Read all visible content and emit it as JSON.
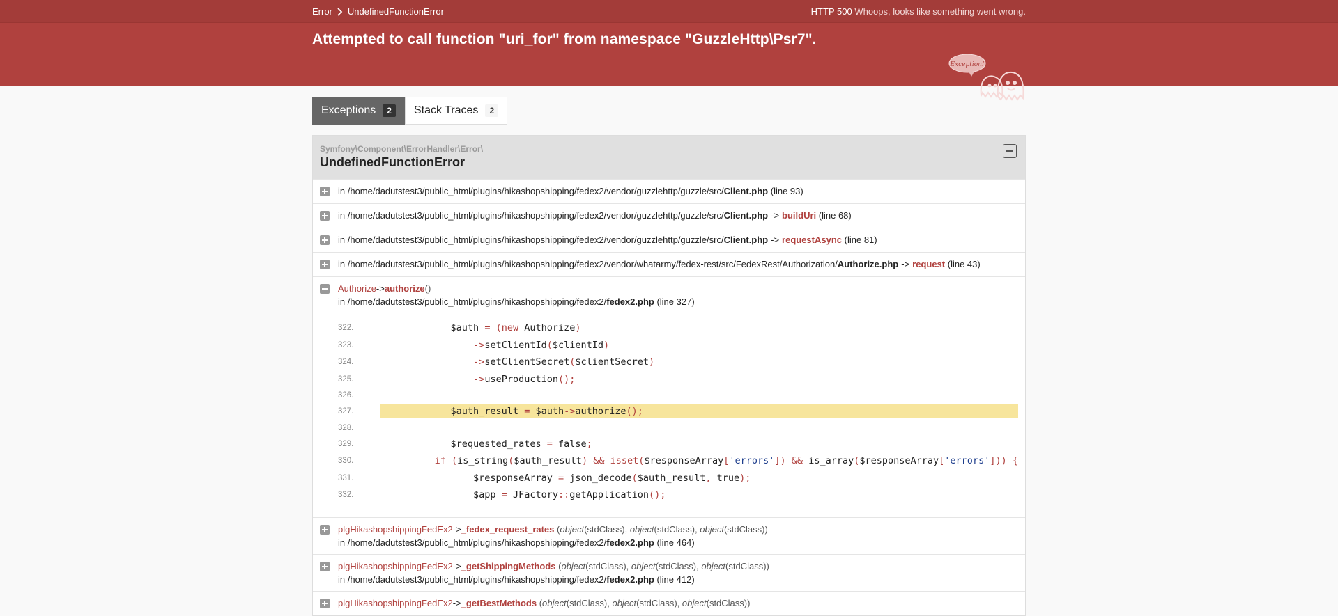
{
  "header": {
    "crumb_root": "Error",
    "crumb_current": "UndefinedFunctionError",
    "status_code": "HTTP 500",
    "status_text": "Whoops, looks like something went wrong.",
    "message": "Attempted to call function \"uri_for\" from namespace \"GuzzleHttp\\Psr7\".",
    "ghost_label": "Exception!"
  },
  "tabs": [
    {
      "label": "Exceptions",
      "count": "2"
    },
    {
      "label": "Stack Traces",
      "count": "2"
    }
  ],
  "exception": {
    "namespace": "Symfony\\Component\\ErrorHandler\\Error\\",
    "name": "UndefinedFunctionError"
  },
  "traces": [
    {
      "path": "in /home/dadutstest3/public_html/plugins/hikashopshipping/fedex2/vendor/guzzlehttp/guzzle/src/",
      "file": "Client.php",
      "fn": "",
      "line": "(line 93)"
    },
    {
      "path": "in /home/dadutstest3/public_html/plugins/hikashopshipping/fedex2/vendor/guzzlehttp/guzzle/src/",
      "file": "Client.php",
      "arrow": "->",
      "fn": "buildUri",
      "line": "(line 68)"
    },
    {
      "path": "in /home/dadutstest3/public_html/plugins/hikashopshipping/fedex2/vendor/guzzlehttp/guzzle/src/",
      "file": "Client.php",
      "arrow": "->",
      "fn": "requestAsync",
      "line": "(line 81)"
    },
    {
      "path": "in /home/dadutstest3/public_html/plugins/hikashopshipping/fedex2/vendor/whatarmy/fedex-rest/src/FedexRest/Authorization/",
      "file": "Authorize.php",
      "arrow": "->",
      "fn": "request",
      "line": "(line 43)"
    }
  ],
  "expanded": {
    "cls": "Authorize",
    "arrow": "->",
    "fn": "authorize",
    "args": "()",
    "path": "in /home/dadutstest3/public_html/plugins/hikashopshipping/fedex2/",
    "file": "fedex2.php",
    "line": "(line 327)"
  },
  "code_numbers": [
    "322.",
    "323.",
    "324.",
    "325.",
    "326.",
    "327.",
    "328.",
    "329.",
    "330.",
    "331.",
    "332."
  ],
  "calls": [
    {
      "cls": "plgHikashopshippingFedEx2",
      "arrow": "->",
      "fn": "_fedex_request_rates",
      "args": [
        "object",
        "(stdClass), ",
        "object",
        "(stdClass), ",
        "object",
        "(stdClass))"
      ],
      "path": "in /home/dadutstest3/public_html/plugins/hikashopshipping/fedex2/",
      "file": "fedex2.php",
      "line": "(line 464)"
    },
    {
      "cls": "plgHikashopshippingFedEx2",
      "arrow": "->",
      "fn": "_getShippingMethods",
      "args": [
        "object",
        "(stdClass), ",
        "object",
        "(stdClass), ",
        "object",
        "(stdClass))"
      ],
      "path": "in /home/dadutstest3/public_html/plugins/hikashopshipping/fedex2/",
      "file": "fedex2.php",
      "line": "(line 412)"
    },
    {
      "cls": "plgHikashopshippingFedEx2",
      "arrow": "->",
      "fn": "_getBestMethods",
      "args": [
        "object",
        "(stdClass), ",
        "object",
        "(stdClass), ",
        "object",
        "(stdClass))"
      ],
      "path": "",
      "file": "",
      "line": ""
    }
  ],
  "colors": {
    "header_bg": "#b0413e",
    "highlight": "#f7e59c",
    "accent": "#b0413e"
  }
}
